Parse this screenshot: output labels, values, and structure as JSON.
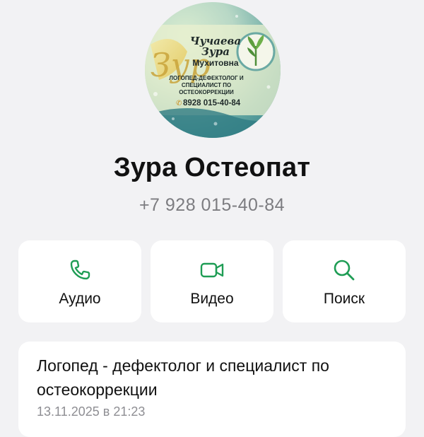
{
  "avatar": {
    "name_line1": "Чучаева",
    "name_line2": "Зура",
    "name_line3": "Мухитовна",
    "role": "ЛОГОПЕД-ДЕФЕКТОЛОГ И СПЕЦИАЛИСТ ПО ОСТЕОКОРРЕКЦИИ",
    "phone": "8928 015-40-84",
    "monogram": "Зур"
  },
  "contact": {
    "name": "Зура Остеопат",
    "phone": "+7 928 015-40-84"
  },
  "actions": {
    "audio": {
      "label": "Аудио",
      "icon": "phone-icon"
    },
    "video": {
      "label": "Видео",
      "icon": "video-camera-icon"
    },
    "search": {
      "label": "Поиск",
      "icon": "search-icon"
    }
  },
  "info": {
    "text": "Логопед - дефектолог и специалист по остеокоррекции",
    "date": "13.11.2025 в 21:23"
  },
  "colors": {
    "accent": "#1f9d55",
    "background": "#f2f2f4",
    "card": "#ffffff",
    "secondary_text": "#7c7c80"
  }
}
